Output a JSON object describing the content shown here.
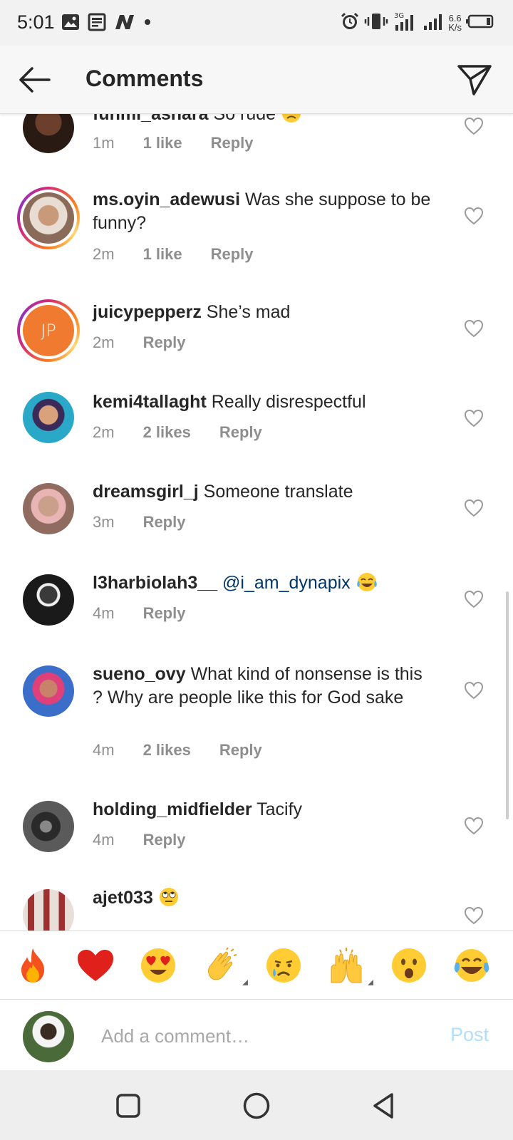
{
  "status_bar": {
    "time": "5:01",
    "left_icons": [
      "gallery-icon",
      "news-icon",
      "n-app-icon",
      "dot-icon"
    ],
    "right_icons": [
      "alarm-icon",
      "vibrate-icon",
      "signal-3g-icon",
      "signal-icon"
    ],
    "speed_value": "6.6",
    "speed_unit": "K/s",
    "battery_icon": "battery-icon"
  },
  "header": {
    "title": "Comments",
    "back_icon": "back-arrow-icon",
    "send_icon": "direct-send-icon"
  },
  "comments": [
    {
      "username": "funmi_ashara",
      "text": "So rude",
      "emoji": "frowning-emoji",
      "time": "1m",
      "likes": "1 like",
      "reply": "Reply",
      "story_ring": false
    },
    {
      "username": "ms.oyin_adewusi",
      "text": "Was she suppose to be funny?",
      "time": "2m",
      "likes": "1 like",
      "reply": "Reply",
      "story_ring": true
    },
    {
      "username": "juicypepperz",
      "text": "She’s mad",
      "time": "2m",
      "likes": "",
      "reply": "Reply",
      "story_ring": true,
      "avatar_initials": "JP"
    },
    {
      "username": "kemi4tallaght",
      "text": "Really disrespectful",
      "time": "2m",
      "likes": "2 likes",
      "reply": "Reply",
      "story_ring": false
    },
    {
      "username": "dreamsgirl_j",
      "text": "Someone translate",
      "time": "3m",
      "likes": "",
      "reply": "Reply",
      "story_ring": false
    },
    {
      "username": "l3harbiolah3__",
      "mention": "@i_am_dynapix",
      "emoji": "tears-of-joy-emoji",
      "time": "4m",
      "likes": "",
      "reply": "Reply",
      "story_ring": false
    },
    {
      "username": "sueno_ovy",
      "text": "What kind of nonsense is this ? Why are people like this for God sake",
      "time": "4m",
      "likes": "2 likes",
      "reply": "Reply",
      "story_ring": false
    },
    {
      "username": "holding_midfielder",
      "text": "Tacify",
      "time": "4m",
      "likes": "",
      "reply": "Reply",
      "story_ring": false
    },
    {
      "username": "ajet033",
      "emoji": "rolling-eyes-emoji",
      "story_ring": false
    }
  ],
  "emoji_bar": [
    "fire-emoji",
    "red-heart-emoji",
    "heart-eyes-emoji",
    "clapping-hands-emoji",
    "crying-emoji",
    "raising-hands-emoji",
    "astonished-emoji",
    "tears-of-joy-emoji"
  ],
  "input": {
    "placeholder": "Add a comment…",
    "value": "",
    "post_label": "Post"
  },
  "nav_bar": [
    "recents-square-icon",
    "home-circle-icon",
    "back-triangle-icon"
  ],
  "colors": {
    "username": "#262626",
    "meta_gray": "#8e8e8e",
    "mention_blue": "#00376b",
    "post_disabled": "#b2dffc",
    "heart_outline": "#9a9a9a"
  }
}
